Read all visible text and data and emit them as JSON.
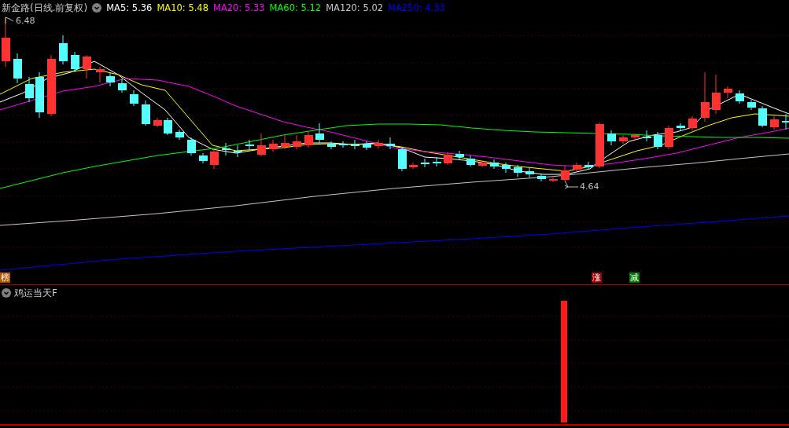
{
  "header": {
    "title": "新金路(日线.前复权)",
    "indicators": [
      {
        "label": "MA5:",
        "value": "5.36",
        "color": "#ffffff"
      },
      {
        "label": "MA10:",
        "value": "5.48",
        "color": "#ffff00"
      },
      {
        "label": "MA20:",
        "value": "5.33",
        "color": "#ff00ff"
      },
      {
        "label": "MA60:",
        "value": "5.12",
        "color": "#00ff00"
      },
      {
        "label": "MA120:",
        "value": "5.02",
        "color": "#c8c8c8"
      },
      {
        "label": "MA250:",
        "value": "4.33",
        "color": "#0000ff"
      }
    ]
  },
  "price_labels": [
    {
      "text": "6.48"
    },
    {
      "text": "4.64"
    }
  ],
  "signals": [
    {
      "text": "榜",
      "color": "#b35a00"
    },
    {
      "text": "涨",
      "color": "#9c0000"
    },
    {
      "text": "减",
      "color": "#007a00"
    }
  ],
  "sub_panel": {
    "title": "鸡运当天F"
  }
}
